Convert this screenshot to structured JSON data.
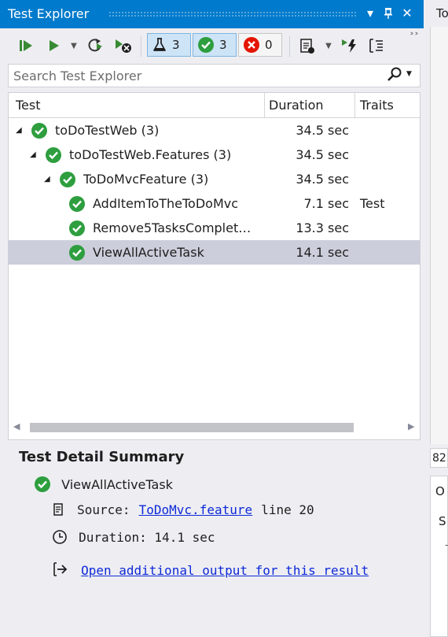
{
  "window": {
    "title": "Test Explorer",
    "right_tab": "To",
    "right_box_text": "82",
    "right_panel_line1": "O",
    "right_panel_line2": "S",
    "right_panel_line3": "-"
  },
  "toolbar": {
    "flask_count": "3",
    "passed_count": "3",
    "failed_count": "0"
  },
  "search": {
    "placeholder": "Search Test Explorer"
  },
  "columns": {
    "test": "Test",
    "duration": "Duration",
    "traits": "Traits"
  },
  "rows": [
    {
      "name": "toDoTestWeb  (3)",
      "duration": "34.5 sec",
      "trait": ""
    },
    {
      "name": "toDoTestWeb.Features  (3)",
      "duration": "34.5 sec",
      "trait": ""
    },
    {
      "name": "ToDoMvcFeature  (3)",
      "duration": "34.5 sec",
      "trait": ""
    },
    {
      "name": "AddItemToTheToDoMvc",
      "duration": "7.1 sec",
      "trait": "Test"
    },
    {
      "name": "Remove5TasksComplet…",
      "duration": "13.3 sec",
      "trait": ""
    },
    {
      "name": "ViewAllActiveTask",
      "duration": "14.1 sec",
      "trait": ""
    }
  ],
  "detail": {
    "title": "Test Detail Summary",
    "test_name": "ViewAllActiveTask",
    "source_label": "Source:",
    "source_link": "ToDoMvc.feature",
    "source_line": "line 20",
    "duration_text": "Duration: 14.1 sec",
    "output_link": "Open additional output for this result"
  },
  "colors": {
    "accent": "#007acc",
    "pass": "#2e9e3f",
    "fail": "#e51400",
    "selected_row": "#cccedb"
  }
}
